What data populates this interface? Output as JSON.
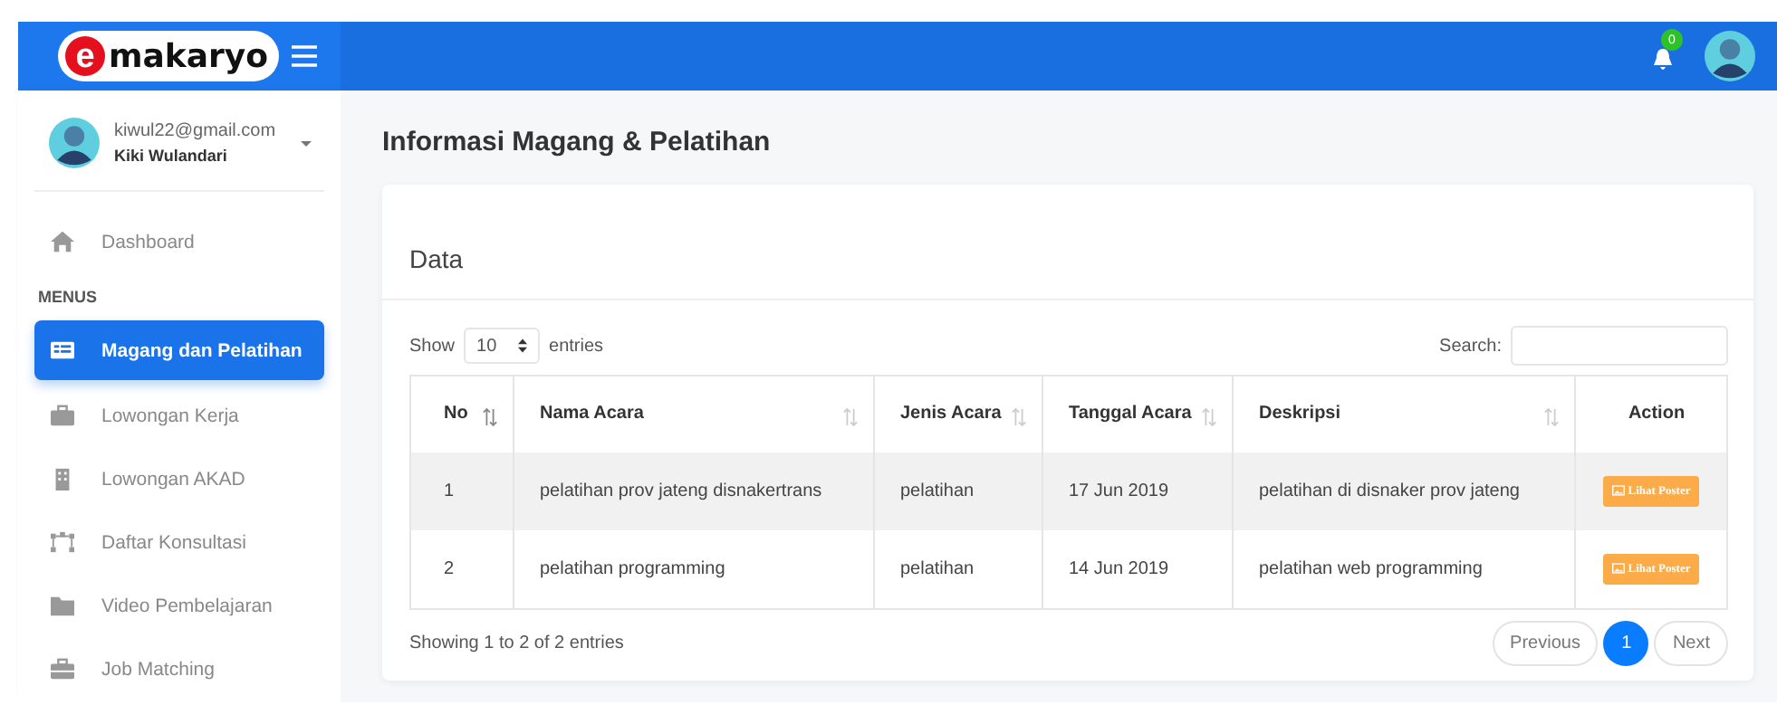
{
  "header": {
    "logo_mark": "e",
    "logo_text": "makaryo",
    "notification_count": "0"
  },
  "user": {
    "email": "kiwul22@gmail.com",
    "name": "Kiki Wulandari"
  },
  "sidebar": {
    "top_item": {
      "label": "Dashboard",
      "selected": false
    },
    "section_label": "MENUS",
    "items": [
      {
        "label": "Magang dan Pelatihan",
        "selected": true
      },
      {
        "label": "Lowongan Kerja",
        "selected": false
      },
      {
        "label": "Lowongan AKAD",
        "selected": false
      },
      {
        "label": "Daftar Konsultasi",
        "selected": false
      },
      {
        "label": "Video Pembelajaran",
        "selected": false
      },
      {
        "label": "Job Matching",
        "selected": false
      }
    ]
  },
  "page_title": "Informasi Magang & Pelatihan",
  "card": {
    "title": "Data",
    "show_label": "Show",
    "page_size": "10",
    "entries_label": "entries",
    "search_label": "Search:",
    "table": {
      "columns": [
        {
          "label": "No",
          "sortable": true
        },
        {
          "label": "Nama Acara",
          "sortable": true
        },
        {
          "label": "Jenis Acara",
          "sortable": true
        },
        {
          "label": "Tanggal Acara",
          "sortable": true
        },
        {
          "label": "Deskripsi",
          "sortable": true
        },
        {
          "label": "Action",
          "sortable": false
        }
      ],
      "rows": [
        {
          "cells": [
            "1",
            "pelatihan prov jateng disnakertrans",
            "pelatihan",
            "17 Jun 2019",
            "pelatihan di disnaker prov jateng"
          ],
          "action": "Lihat Poster"
        },
        {
          "cells": [
            "2",
            "pelatihan programming",
            "pelatihan",
            "14 Jun 2019",
            "pelatihan web programming"
          ],
          "action": "Lihat Poster"
        }
      ]
    },
    "info": "Showing 1 to 2 of 2 entries",
    "pagination": [
      {
        "label": "Previous",
        "selected": false
      },
      {
        "label": "1",
        "selected": true
      },
      {
        "label": "Next",
        "selected": false
      }
    ]
  }
}
